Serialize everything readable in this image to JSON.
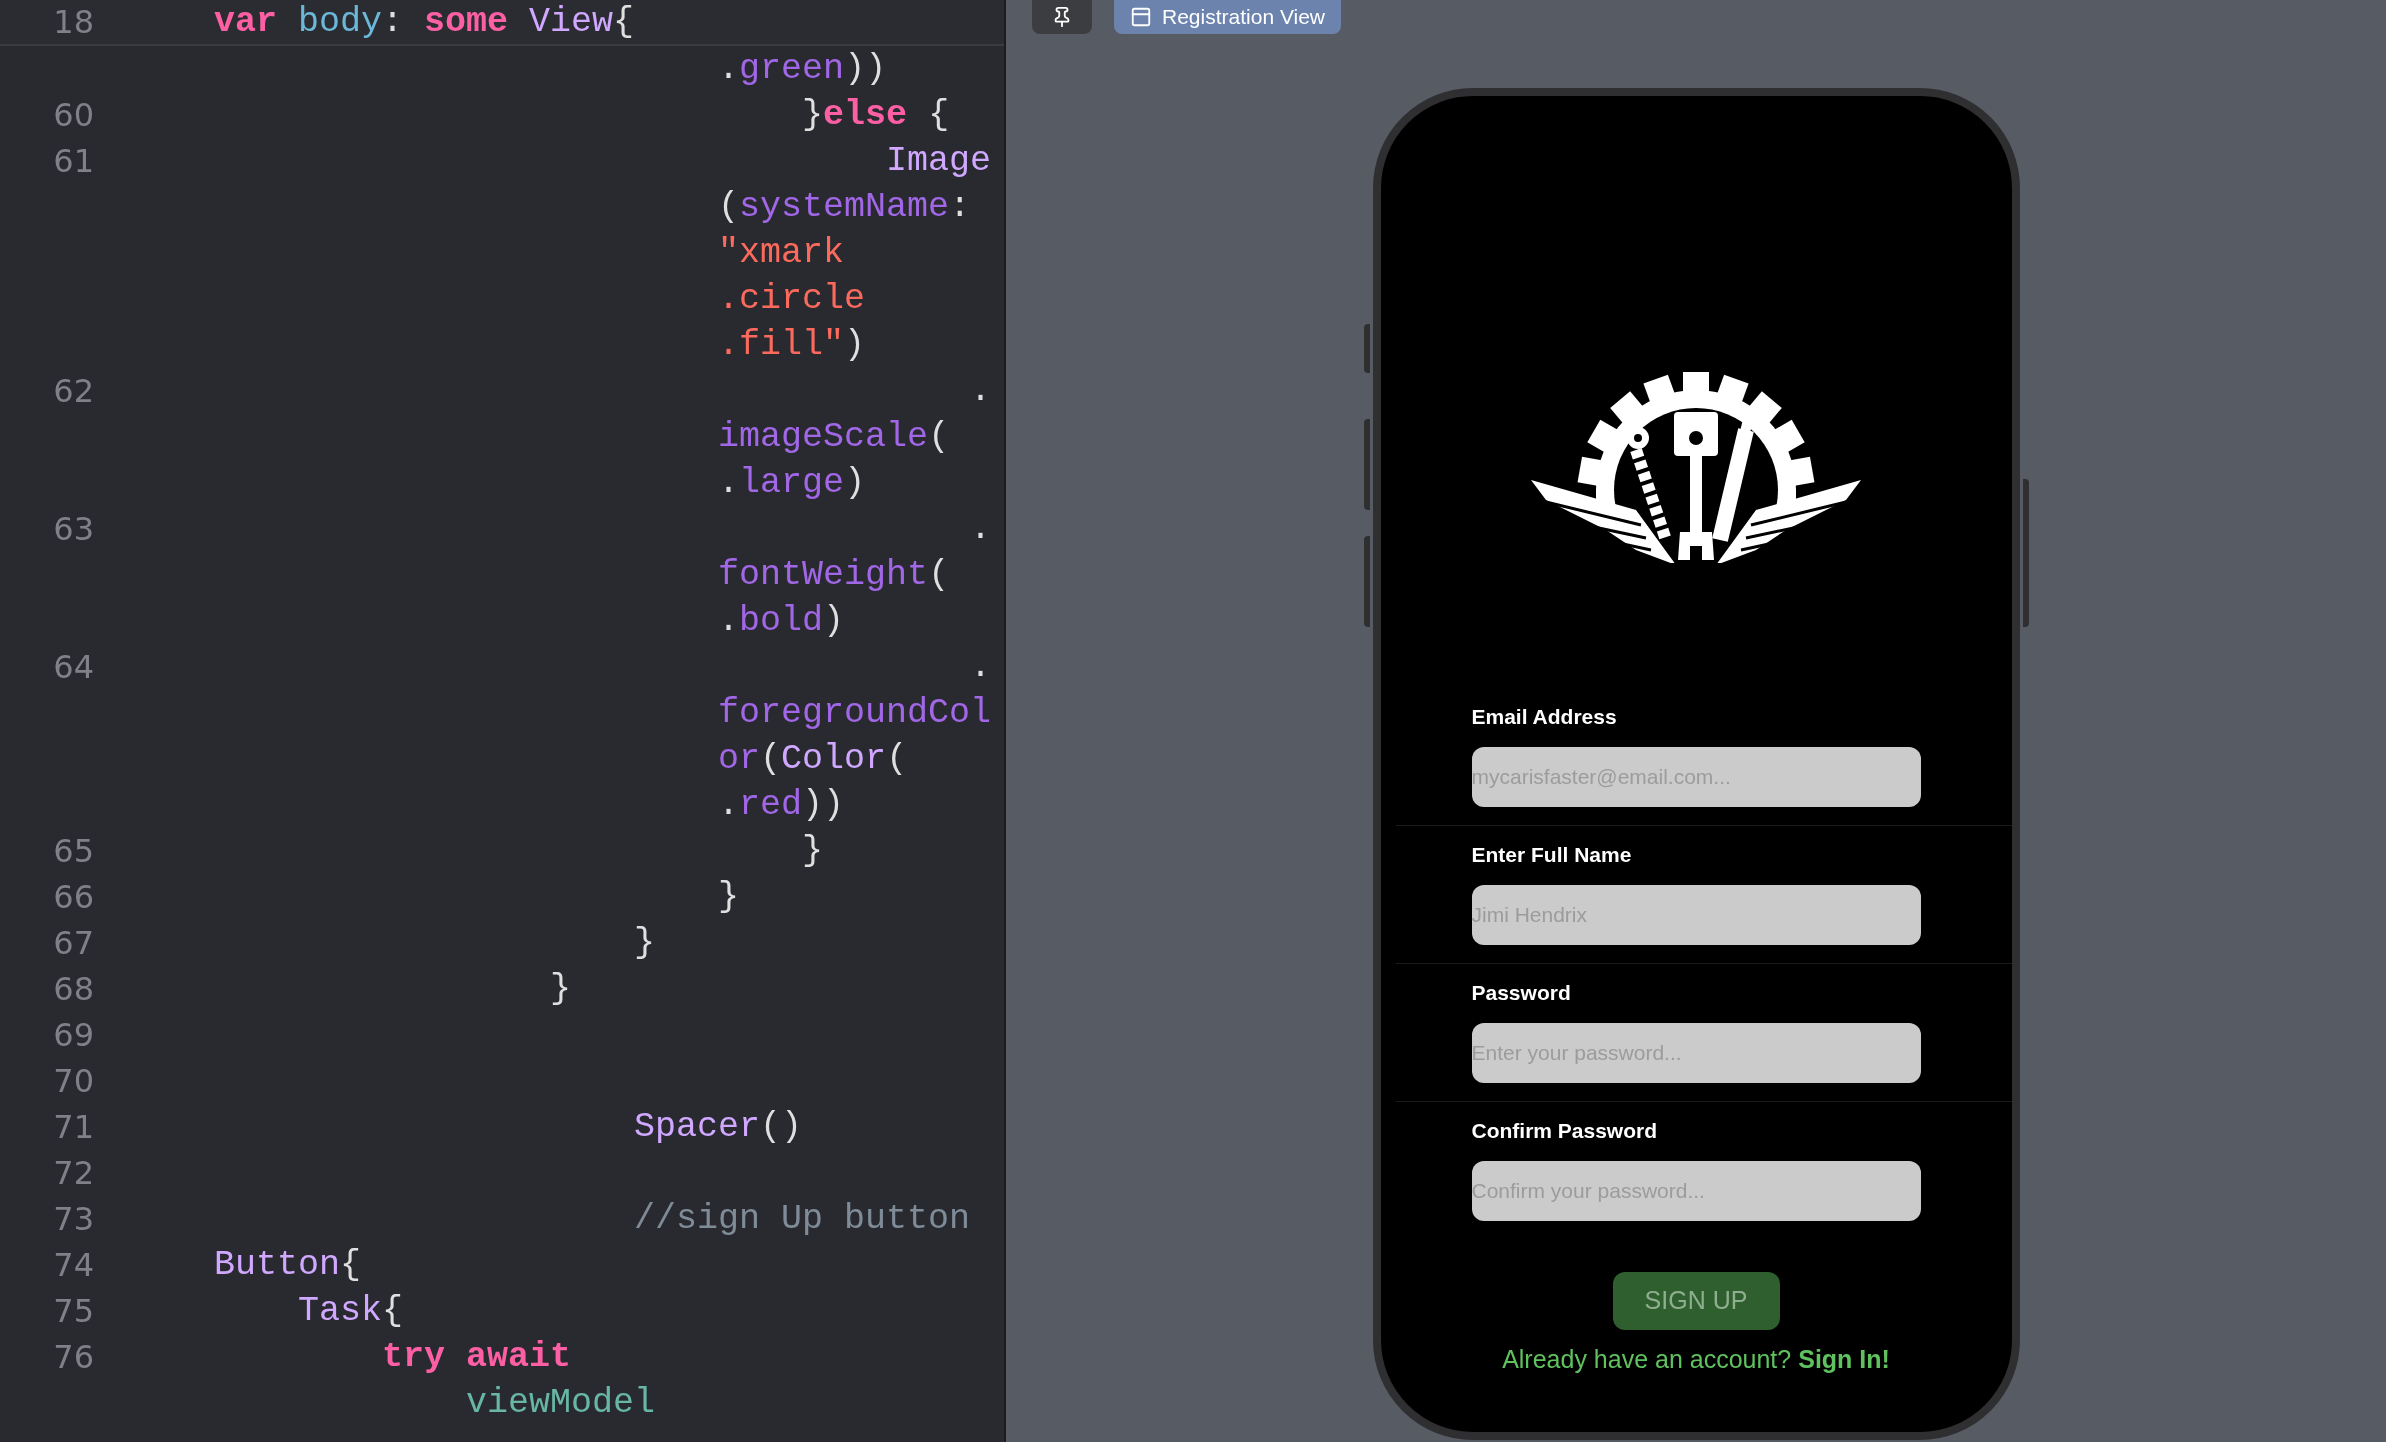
{
  "editor": {
    "sticky_line": {
      "number": "18",
      "tokens": [
        {
          "kind": "keyword",
          "text": "var"
        },
        {
          "kind": "decl",
          "text": " body"
        },
        {
          "kind": "plain",
          "text": ": "
        },
        {
          "kind": "keyword",
          "text": "some"
        },
        {
          "kind": "type",
          "text": " View"
        },
        {
          "kind": "plain",
          "text": "{"
        }
      ]
    },
    "lines": [
      {
        "tokens": [
          {
            "kind": "plain",
            "text": "                        ."
          },
          {
            "kind": "member",
            "text": "green"
          },
          {
            "kind": "plain",
            "text": "))"
          }
        ]
      },
      {
        "number": "60",
        "tokens": [
          {
            "kind": "plain",
            "text": "                            }"
          },
          {
            "kind": "keyword",
            "text": "else"
          },
          {
            "kind": "plain",
            "text": " {"
          }
        ]
      },
      {
        "number": "61",
        "tokens": [
          {
            "kind": "type",
            "text": "                                Image"
          }
        ]
      },
      {
        "tokens": [
          {
            "kind": "plain",
            "text": "                        ("
          },
          {
            "kind": "member",
            "text": "systemName"
          },
          {
            "kind": "plain",
            "text": ":"
          }
        ]
      },
      {
        "tokens": [
          {
            "kind": "string",
            "text": "                        \"xmark"
          }
        ]
      },
      {
        "tokens": [
          {
            "kind": "string",
            "text": "                        .circle"
          }
        ]
      },
      {
        "tokens": [
          {
            "kind": "string",
            "text": "                        .fill\""
          },
          {
            "kind": "plain",
            "text": ")"
          }
        ]
      },
      {
        "number": "62",
        "tokens": [
          {
            "kind": "plain",
            "text": "                                    ."
          }
        ]
      },
      {
        "tokens": [
          {
            "kind": "member",
            "text": "                        imageScale"
          },
          {
            "kind": "plain",
            "text": "("
          }
        ]
      },
      {
        "tokens": [
          {
            "kind": "plain",
            "text": "                        ."
          },
          {
            "kind": "member",
            "text": "large"
          },
          {
            "kind": "plain",
            "text": ")"
          }
        ]
      },
      {
        "number": "63",
        "tokens": [
          {
            "kind": "plain",
            "text": "                                    ."
          }
        ]
      },
      {
        "tokens": [
          {
            "kind": "member",
            "text": "                        fontWeight"
          },
          {
            "kind": "plain",
            "text": "("
          }
        ]
      },
      {
        "tokens": [
          {
            "kind": "plain",
            "text": "                        ."
          },
          {
            "kind": "member",
            "text": "bold"
          },
          {
            "kind": "plain",
            "text": ")"
          }
        ]
      },
      {
        "number": "64",
        "tokens": [
          {
            "kind": "plain",
            "text": "                                    ."
          }
        ]
      },
      {
        "tokens": [
          {
            "kind": "member",
            "text": "                        foregroundCol"
          }
        ]
      },
      {
        "tokens": [
          {
            "kind": "member",
            "text": "                        or"
          },
          {
            "kind": "plain",
            "text": "("
          },
          {
            "kind": "type",
            "text": "Color"
          },
          {
            "kind": "plain",
            "text": "("
          }
        ]
      },
      {
        "tokens": [
          {
            "kind": "plain",
            "text": "                        ."
          },
          {
            "kind": "member",
            "text": "red"
          },
          {
            "kind": "plain",
            "text": "))"
          }
        ]
      },
      {
        "number": "65",
        "tokens": [
          {
            "kind": "plain",
            "text": "                            }"
          }
        ]
      },
      {
        "number": "66",
        "tokens": [
          {
            "kind": "plain",
            "text": "                        }"
          }
        ]
      },
      {
        "number": "67",
        "tokens": [
          {
            "kind": "plain",
            "text": "                    }"
          }
        ]
      },
      {
        "number": "68",
        "tokens": [
          {
            "kind": "plain",
            "text": "                }"
          }
        ]
      },
      {
        "number": "69"
      },
      {
        "number": "70"
      },
      {
        "number": "71",
        "tokens": [
          {
            "kind": "type",
            "text": "                    Spacer"
          },
          {
            "kind": "plain",
            "text": "()"
          }
        ]
      },
      {
        "number": "72"
      },
      {
        "number": "73",
        "tokens": [
          {
            "kind": "comment",
            "text": "                    //sign Up button"
          }
        ]
      },
      {
        "number": "74",
        "tokens": [
          {
            "kind": "type",
            "text": "Button"
          },
          {
            "kind": "plain",
            "text": "{"
          }
        ]
      },
      {
        "number": "75",
        "tokens": [
          {
            "kind": "type",
            "text": "    Task"
          },
          {
            "kind": "plain",
            "text": "{"
          }
        ]
      },
      {
        "number": "76",
        "tokens": [
          {
            "kind": "keyword",
            "text": "        try await"
          }
        ]
      },
      {
        "tokens": [
          {
            "kind": "var",
            "text": "            viewModel"
          }
        ]
      }
    ]
  },
  "preview": {
    "tab": {
      "label": "Registration View"
    },
    "form": {
      "fields": [
        {
          "label": "Email Address",
          "placeholder": "mycarisfaster@email.com..."
        },
        {
          "label": "Enter Full Name",
          "placeholder": "Jimi Hendrix"
        },
        {
          "label": "Password",
          "placeholder": "Enter your password..."
        },
        {
          "label": "Confirm Password",
          "placeholder": "Confirm your password..."
        }
      ],
      "submit": "SIGN UP",
      "signin_prompt": {
        "text": "Already have an account?",
        "link": "Sign In!"
      }
    }
  }
}
